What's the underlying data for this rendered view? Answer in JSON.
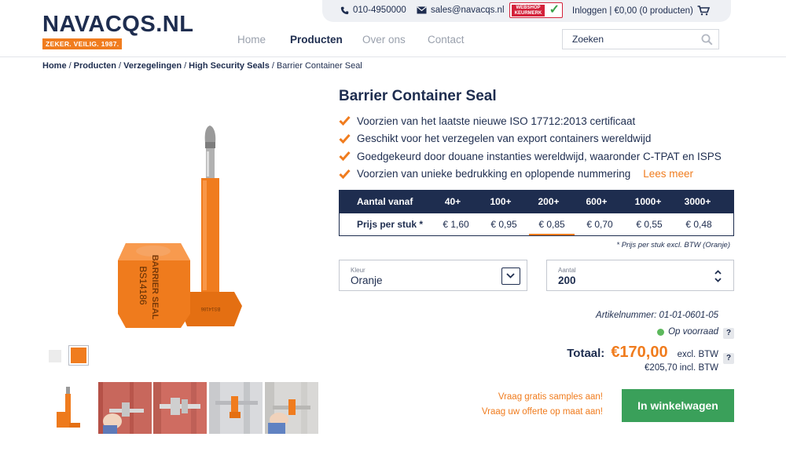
{
  "topbar": {
    "phone": "010-4950000",
    "email": "sales@navacqs.nl",
    "badge": {
      "line1": "WEBSHOP",
      "line2": "KEURMERK"
    },
    "account": "Inloggen | €0,00 (0 producten)"
  },
  "logo": {
    "word": "NAVACQS.NL",
    "tagline": "ZEKER. VEILIG. 1987."
  },
  "nav": [
    {
      "label": "Home",
      "active": false
    },
    {
      "label": "Producten",
      "active": true
    },
    {
      "label": "Over ons",
      "active": false
    },
    {
      "label": "Contact",
      "active": false
    }
  ],
  "search": {
    "placeholder": "Zoeken"
  },
  "breadcrumb": {
    "links": [
      "Home",
      "Producten",
      "Verzegelingen",
      "High Security Seals"
    ],
    "current": "Barrier Container Seal"
  },
  "product": {
    "title": "Barrier Container Seal",
    "image_text": {
      "upright": "BARRIER SEAL",
      "number": "BS14186"
    },
    "features": [
      "Voorzien van het laatste nieuwe ISO 17712:2013 certificaat",
      "Geschikt voor het verzegelen van export containers wereldwijd",
      "Goedgekeurd door douane instanties wereldwijd, waaronder C-TPAT en ISPS",
      "Voorzien van unieke bedrukking en oplopende nummering"
    ],
    "read_more": "Lees meer"
  },
  "price_table": {
    "header_label": "Aantal vanaf",
    "row_label": "Prijs per stuk *",
    "tiers": [
      "40+",
      "100+",
      "200+",
      "600+",
      "1000+",
      "3000+"
    ],
    "prices": [
      "€ 1,60",
      "€ 0,95",
      "€ 0,85",
      "€ 0,70",
      "€ 0,55",
      "€ 0,48"
    ],
    "active_tier": "200+",
    "note": "* Prijs per stuk excl. BTW  (Oranje)"
  },
  "options": {
    "color_label": "Kleur",
    "color_value": "Oranje",
    "quantity_label": "Aantal",
    "quantity_value": "200"
  },
  "meta": {
    "article_number": "Artikelnummer: 01-01-0601-05",
    "stock": "Op voorraad",
    "help": "?"
  },
  "totals": {
    "label": "Totaal:",
    "value": "€170,00",
    "excl": "excl. BTW",
    "incl": "€205,70 incl. BTW"
  },
  "actions": {
    "samples": "Vraag gratis samples aan!",
    "quote": "Vraag uw offerte op maat aan!",
    "cart": "In winkelwagen"
  },
  "colors": {
    "navy": "#1e2d4f",
    "orange": "#f07c1e",
    "green": "#3aa05a",
    "stock_green": "#5cb85c"
  }
}
